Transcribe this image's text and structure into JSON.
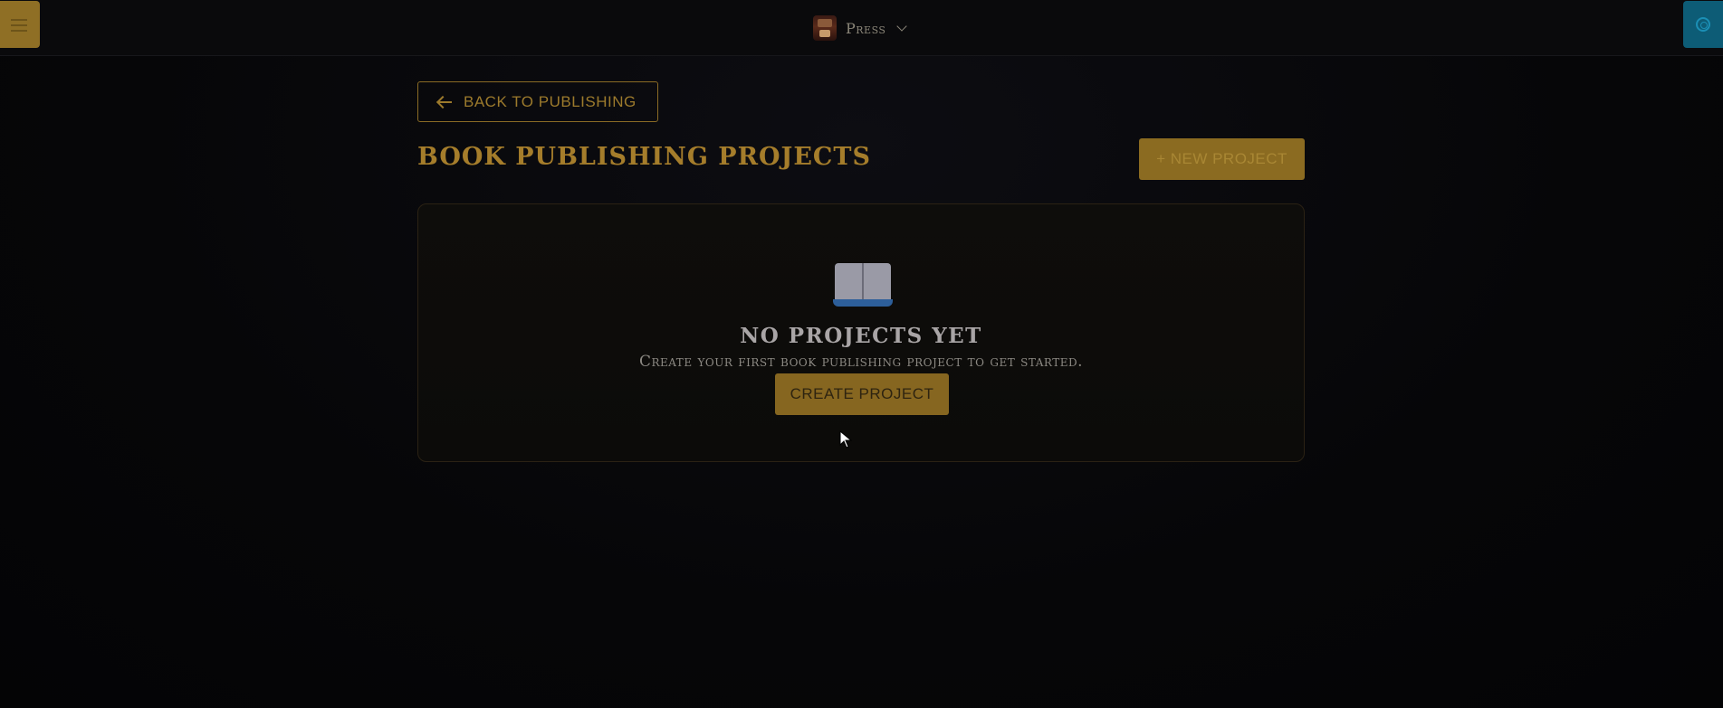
{
  "header": {
    "brand_name": "Press",
    "icons": {
      "menu": "menu-icon",
      "settings": "gear-icon",
      "brand": "press-logo-icon",
      "dropdown": "chevron-down-icon"
    },
    "colors": {
      "menu_bg": "#8f6f25",
      "settings_bg": "#0d5c76"
    }
  },
  "navigation": {
    "back_label": "BACK TO PUBLISHING",
    "back_icon": "arrow-left-icon"
  },
  "main": {
    "title": "BOOK PUBLISHING PROJECTS",
    "new_project_label": "+ NEW PROJECT",
    "accent_color": "#a57d2b"
  },
  "empty_state": {
    "icon": "open-book-icon",
    "title": "NO PROJECTS YET",
    "description": "Create your first book publishing project to get started.",
    "create_label": "CREATE PROJECT"
  }
}
